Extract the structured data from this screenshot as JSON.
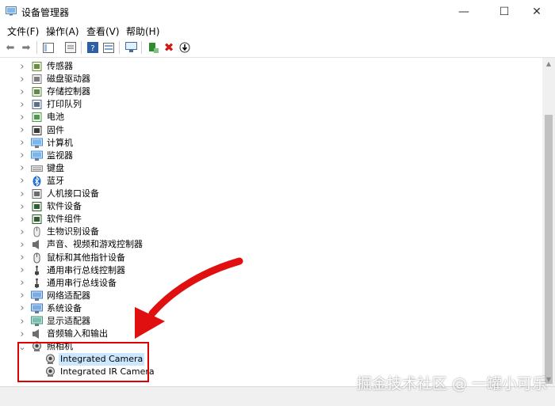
{
  "window": {
    "title": "设备管理器"
  },
  "menu": [
    "文件(F)",
    "操作(A)",
    "查看(V)",
    "帮助(H)"
  ],
  "tree": [
    {
      "label": "传感器",
      "icon": "sensor-icon"
    },
    {
      "label": "磁盘驱动器",
      "icon": "disk-drive-icon"
    },
    {
      "label": "存储控制器",
      "icon": "storage-controller-icon"
    },
    {
      "label": "打印队列",
      "icon": "printer-icon"
    },
    {
      "label": "电池",
      "icon": "battery-icon"
    },
    {
      "label": "固件",
      "icon": "firmware-icon"
    },
    {
      "label": "计算机",
      "icon": "computer-icon"
    },
    {
      "label": "监视器",
      "icon": "monitor-icon"
    },
    {
      "label": "键盘",
      "icon": "keyboard-icon"
    },
    {
      "label": "蓝牙",
      "icon": "bluetooth-icon"
    },
    {
      "label": "人机接口设备",
      "icon": "hid-icon"
    },
    {
      "label": "软件设备",
      "icon": "software-device-icon"
    },
    {
      "label": "软件组件",
      "icon": "software-component-icon"
    },
    {
      "label": "生物识别设备",
      "icon": "fingerprint-icon"
    },
    {
      "label": "声音、视频和游戏控制器",
      "icon": "speaker-icon"
    },
    {
      "label": "鼠标和其他指针设备",
      "icon": "mouse-icon"
    },
    {
      "label": "通用串行总线控制器",
      "icon": "usb-icon"
    },
    {
      "label": "通用串行总线设备",
      "icon": "usb-icon"
    },
    {
      "label": "网络适配器",
      "icon": "network-adapter-icon"
    },
    {
      "label": "系统设备",
      "icon": "system-device-icon"
    },
    {
      "label": "显示适配器",
      "icon": "display-adapter-icon"
    },
    {
      "label": "音频输入和输出",
      "icon": "audio-io-icon"
    },
    {
      "label": "照相机",
      "icon": "camera-icon",
      "expanded": true
    },
    {
      "label": "Integrated Camera",
      "icon": "camera-icon",
      "child": true,
      "selected": true
    },
    {
      "label": "Integrated IR Camera",
      "icon": "camera-icon",
      "child": true
    }
  ],
  "watermark": "掘金技术社区 @ 一罐小可乐",
  "colors": {
    "selection": "#cce8ff",
    "highlight": "#e00000"
  }
}
